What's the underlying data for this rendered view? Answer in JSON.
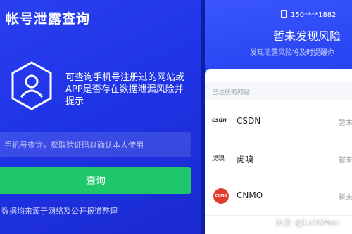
{
  "left": {
    "title": "帐号泄露查询",
    "description": "可查询手机号注册过的网站或APP是否存在数据泄漏风险并提示",
    "input_placeholder": "手机号查询，获取验证码以确认本人使用",
    "query_button": "查询",
    "source_note": "数据均来源于网络及公开报道整理"
  },
  "right": {
    "phone": "150****1882",
    "title": "暂未发现风险",
    "subtitle": "发现泄露风险将及时提醒你",
    "section_label": "已注册的网站",
    "sites": [
      {
        "logo": "csdn",
        "name": "CSDN",
        "status": "暂未"
      },
      {
        "logo": "虎嗅",
        "name": "虎嗅",
        "status": "暂未"
      },
      {
        "logo": "CNMO",
        "name": "CNMO",
        "status": "暂未"
      }
    ]
  },
  "watermark": "头条 @LuisWuu",
  "colors": {
    "accent_green": "#1fc76b",
    "background_blue": "#1f34e6"
  }
}
